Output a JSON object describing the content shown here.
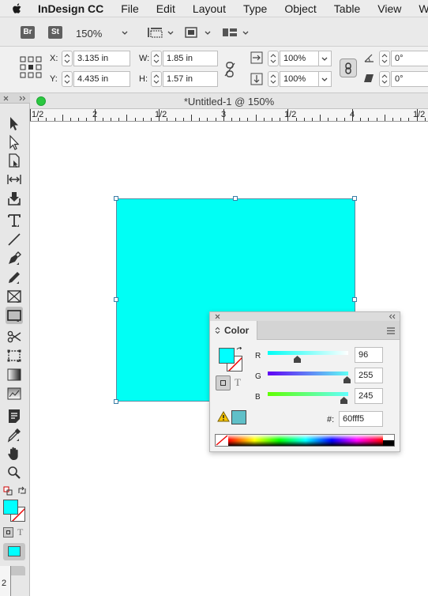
{
  "menubar": {
    "app_name": "InDesign CC",
    "items": [
      "File",
      "Edit",
      "Layout",
      "Type",
      "Object",
      "Table",
      "View",
      "Wind"
    ]
  },
  "appbar": {
    "bridge_badge": "Br",
    "stock_badge": "St",
    "zoom": "150%"
  },
  "control": {
    "x_label": "X:",
    "x_value": "3.135 in",
    "y_label": "Y:",
    "y_value": "4.435 in",
    "w_label": "W:",
    "w_value": "1.85 in",
    "h_label": "H:",
    "h_value": "1.57 in",
    "scale_x": "100%",
    "scale_y": "100%",
    "rotate": "0°",
    "shear": "0°"
  },
  "document": {
    "title": "*Untitled-1 @ 150%",
    "ruler_labels": [
      "1/2",
      "2",
      "1/2",
      "3",
      "1/2",
      "4",
      "1/2"
    ],
    "vruler_label": "2"
  },
  "color_panel": {
    "tab_label": "Color",
    "r_label": "R",
    "r_value": "96",
    "g_label": "G",
    "g_value": "255",
    "b_label": "B",
    "b_value": "245",
    "hex_label": "#:",
    "hex_value": "60fff5",
    "type_glyph": "T"
  },
  "colors": {
    "fill": "#00fff5",
    "swatch_fill": "#00ffff",
    "out_of_gamut": "#60c0c8",
    "selection": "#3c7ea6"
  }
}
